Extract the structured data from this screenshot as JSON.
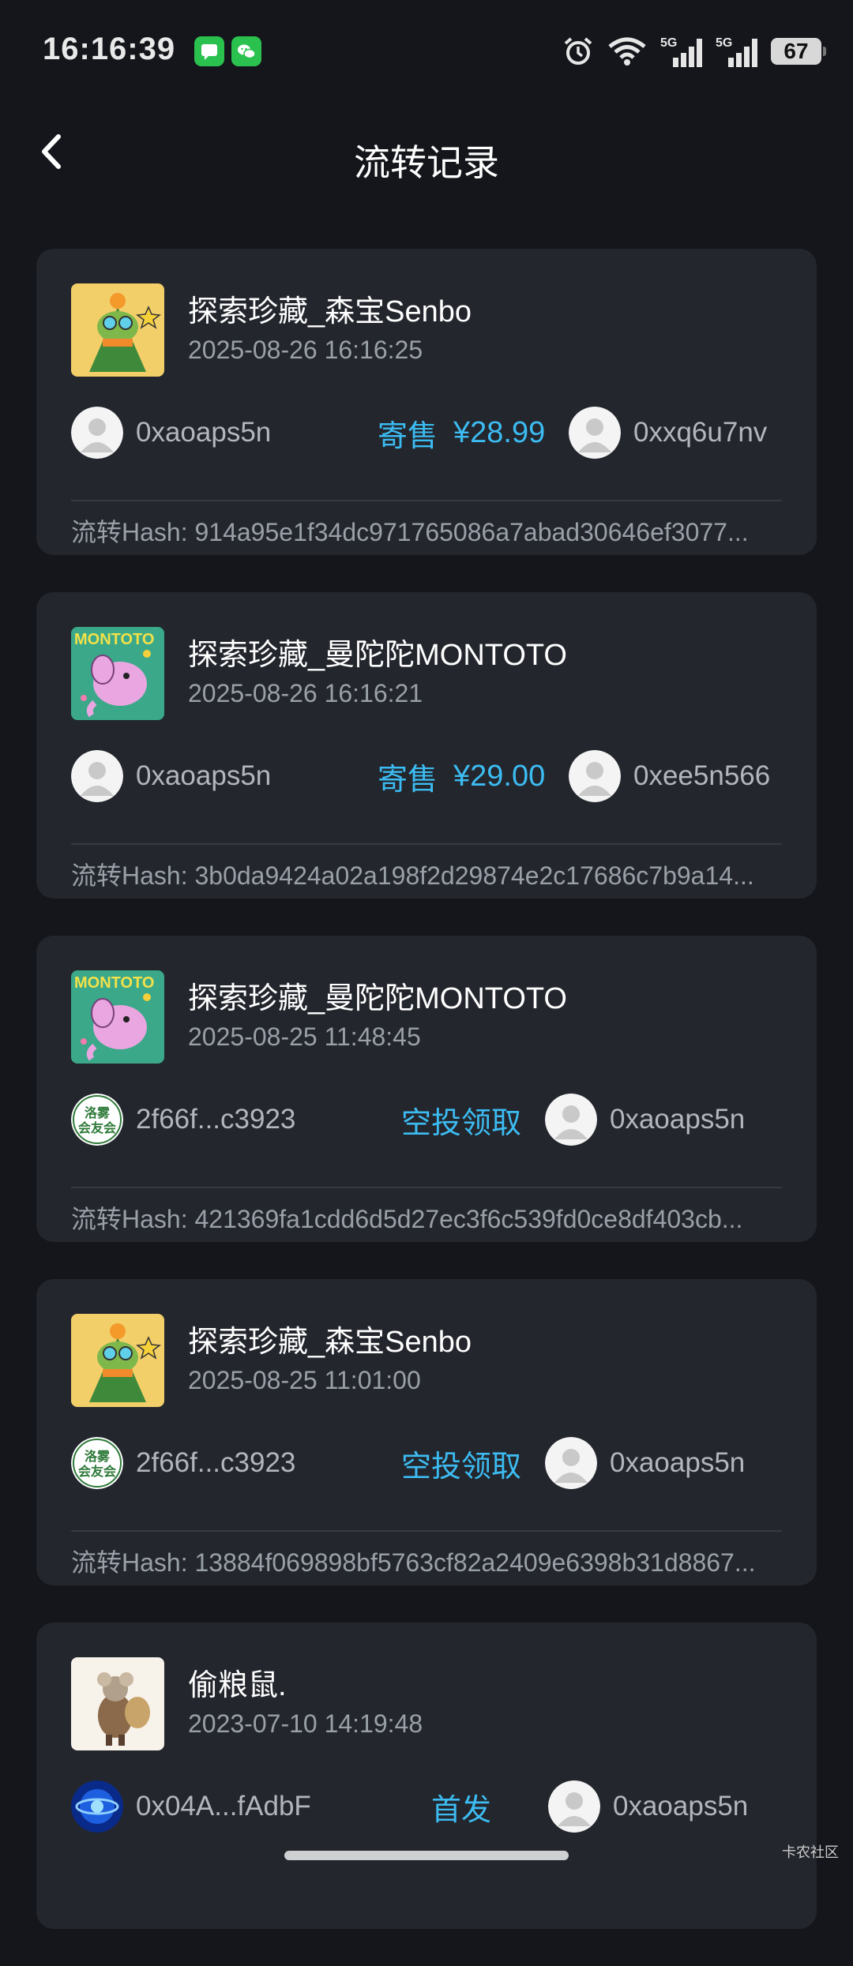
{
  "status_bar": {
    "time": "16:16:39",
    "battery": "67",
    "icons": [
      "messages-app-icon",
      "wechat-app-icon",
      "alarm-icon",
      "wifi-icon",
      "signal-5g-icon",
      "signal-5g-icon",
      "battery-icon"
    ]
  },
  "header": {
    "title": "流转记录",
    "back_icon": "chevron-left-icon"
  },
  "records": [
    {
      "name": "探索珍藏_森宝Senbo",
      "date": "2025-08-26 16:16:25",
      "from": "0xaoaps5n",
      "action": "寄售",
      "price": "¥28.99",
      "to": "0xxq6u7nv",
      "hash": "流转Hash: 914a95e1f34dc971765086a7abad30646ef3077..."
    },
    {
      "name": "探索珍藏_曼陀陀MONTOTO",
      "date": "2025-08-26 16:16:21",
      "from": "0xaoaps5n",
      "action": "寄售",
      "price": "¥29.00",
      "to": "0xee5n566",
      "hash": "流转Hash: 3b0da9424a02a198f2d29874e2c17686c7b9a14..."
    },
    {
      "name": "探索珍藏_曼陀陀MONTOTO",
      "date": "2025-08-25 11:48:45",
      "from": "2f66f...c3923",
      "action": "空投领取",
      "price": "",
      "to": "0xaoaps5n",
      "hash": "流转Hash: 421369fa1cdd6d5d27ec3f6c539fd0ce8df403cb..."
    },
    {
      "name": "探索珍藏_森宝Senbo",
      "date": "2025-08-25 11:01:00",
      "from": "2f66f...c3923",
      "action": "空投领取",
      "price": "",
      "to": "0xaoaps5n",
      "hash": "流转Hash: 13884f069898bf5763cf82a2409e6398b31d8867..."
    },
    {
      "name": "偷粮鼠.",
      "date": "2023-07-10 14:19:48",
      "from": "0x04A...fAdbF",
      "action": "首发",
      "price": "",
      "to": "0xaoaps5n",
      "hash": ""
    }
  ],
  "club_badge_text": "洛雾会友会",
  "watermark": "卡农社区",
  "colors": {
    "background": "#14161b",
    "card": "#23262d",
    "accent": "#3cbcf2",
    "secondary_text": "#9aa0a8"
  }
}
